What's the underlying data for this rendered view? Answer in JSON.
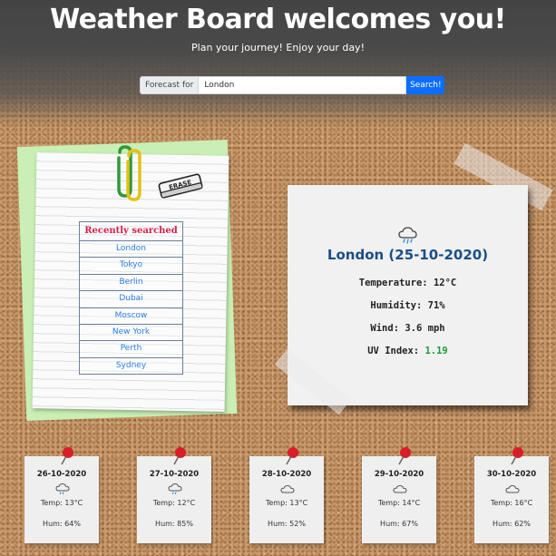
{
  "header": {
    "title": "Weather Board welcomes you!",
    "subtitle": "Plan your journey! Enjoy your day!"
  },
  "search": {
    "addon_label": "Forecast for",
    "value": "London",
    "button_label": "Search!"
  },
  "history": {
    "eraser_label": "ERASE",
    "heading": "Recently searched",
    "cities": [
      "London",
      "Tokyo",
      "Berlin",
      "Dubai",
      "Moscow",
      "New York",
      "Perth",
      "Sydney"
    ]
  },
  "current": {
    "icon": "rain-cloud-icon",
    "title": "London (25-10-2020)",
    "temperature": "Temperature: 12°C",
    "humidity": "Humidity: 71%",
    "wind": "Wind: 3.6 mph",
    "uv_label": "UV Index:",
    "uv_value": "1.19",
    "uv_color": "#1a9a36"
  },
  "forecast": [
    {
      "date": "26-10-2020",
      "icon": "rain-cloud-icon",
      "temp": "Temp: 13°C",
      "hum": "Hum: 64%"
    },
    {
      "date": "27-10-2020",
      "icon": "rain-cloud-icon",
      "temp": "Temp: 12°C",
      "hum": "Hum: 85%"
    },
    {
      "date": "28-10-2020",
      "icon": "cloud-icon",
      "temp": "Temp: 13°C",
      "hum": "Hum: 52%"
    },
    {
      "date": "29-10-2020",
      "icon": "cloud-icon",
      "temp": "Temp: 14°C",
      "hum": "Hum: 67%"
    },
    {
      "date": "30-10-2020",
      "icon": "cloud-icon",
      "temp": "Temp: 16°C",
      "hum": "Hum: 62%"
    }
  ],
  "colors": {
    "title_color": "#1c4e86",
    "history_heading": "#d6204a",
    "history_link": "#2a7de1",
    "search_button": "#0d6efd"
  }
}
